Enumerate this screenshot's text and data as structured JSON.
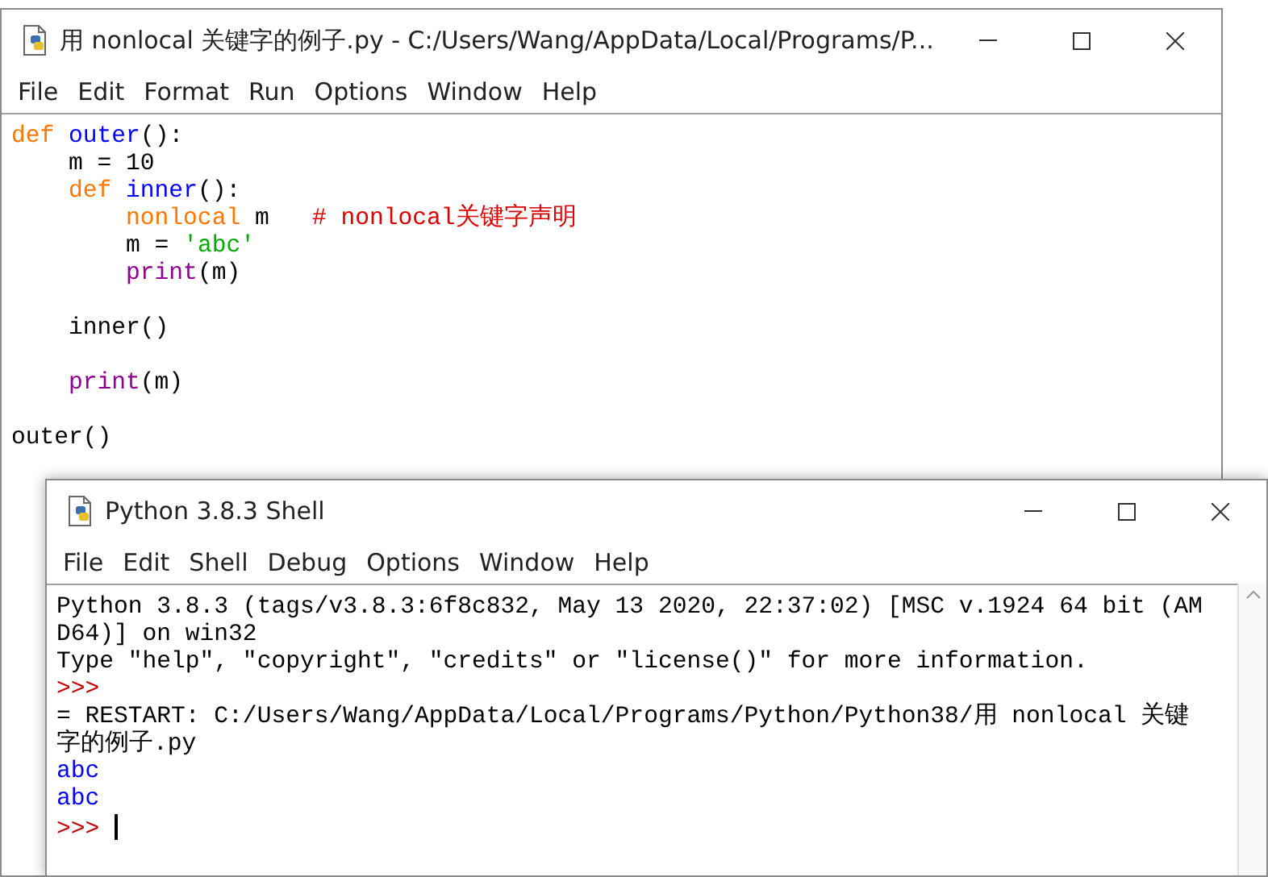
{
  "editor_window": {
    "title": "用 nonlocal 关键字的例子.py - C:/Users/Wang/AppData/Local/Programs/P...",
    "menu": [
      "File",
      "Edit",
      "Format",
      "Run",
      "Options",
      "Window",
      "Help"
    ],
    "lines": [
      {
        "kind": "code",
        "tokens": [
          {
            "kind": "keyword",
            "text": "def "
          },
          {
            "kind": "definition",
            "text": "outer"
          },
          {
            "kind": "plain",
            "text": "():"
          }
        ]
      },
      {
        "kind": "code",
        "tokens": [
          {
            "kind": "plain",
            "text": "    m = 10"
          }
        ]
      },
      {
        "kind": "code",
        "tokens": [
          {
            "kind": "keyword",
            "text": "    def "
          },
          {
            "kind": "definition",
            "text": "inner"
          },
          {
            "kind": "plain",
            "text": "():"
          }
        ]
      },
      {
        "kind": "code",
        "tokens": [
          {
            "kind": "keyword",
            "text": "        nonlocal"
          },
          {
            "kind": "plain",
            "text": " m   "
          },
          {
            "kind": "comment",
            "text": "# nonlocal关键字声明"
          }
        ]
      },
      {
        "kind": "code",
        "tokens": [
          {
            "kind": "plain",
            "text": "        m = "
          },
          {
            "kind": "string",
            "text": "'abc'"
          }
        ]
      },
      {
        "kind": "code",
        "tokens": [
          {
            "kind": "builtin",
            "text": "        print"
          },
          {
            "kind": "plain",
            "text": "(m)"
          }
        ]
      },
      {
        "kind": "blank"
      },
      {
        "kind": "code",
        "tokens": [
          {
            "kind": "plain",
            "text": "    inner()"
          }
        ]
      },
      {
        "kind": "blank"
      },
      {
        "kind": "code",
        "tokens": [
          {
            "kind": "builtin",
            "text": "    print"
          },
          {
            "kind": "plain",
            "text": "(m)"
          }
        ]
      },
      {
        "kind": "blank"
      },
      {
        "kind": "code",
        "tokens": [
          {
            "kind": "plain",
            "text": "outer()"
          }
        ]
      }
    ]
  },
  "shell_window": {
    "title": "Python 3.8.3 Shell",
    "menu": [
      "File",
      "Edit",
      "Shell",
      "Debug",
      "Options",
      "Window",
      "Help"
    ],
    "lines": [
      {
        "kind": "code",
        "tokens": [
          {
            "kind": "plain",
            "text": "Python 3.8.3 (tags/v3.8.3:6f8c832, May 13 2020, 22:37:02) [MSC v.1924 64 bit (AM"
          }
        ]
      },
      {
        "kind": "code",
        "tokens": [
          {
            "kind": "plain",
            "text": "D64)] on win32"
          }
        ]
      },
      {
        "kind": "code",
        "tokens": [
          {
            "kind": "plain",
            "text": "Type \"help\", \"copyright\", \"credits\" or \"license()\" for more information."
          }
        ]
      },
      {
        "kind": "code",
        "tokens": [
          {
            "kind": "prompt",
            "text": ">>>"
          }
        ]
      },
      {
        "kind": "code",
        "tokens": [
          {
            "kind": "plain",
            "text": "= RESTART: C:/Users/Wang/AppData/Local/Programs/Python/Python38/用 nonlocal 关键"
          }
        ]
      },
      {
        "kind": "code",
        "tokens": [
          {
            "kind": "plain",
            "text": "字的例子.py"
          }
        ]
      },
      {
        "kind": "code",
        "tokens": [
          {
            "kind": "output",
            "text": "abc"
          }
        ]
      },
      {
        "kind": "code",
        "tokens": [
          {
            "kind": "output",
            "text": "abc"
          }
        ]
      },
      {
        "kind": "code",
        "cursor": true,
        "tokens": [
          {
            "kind": "prompt",
            "text": ">>> "
          }
        ]
      }
    ]
  }
}
